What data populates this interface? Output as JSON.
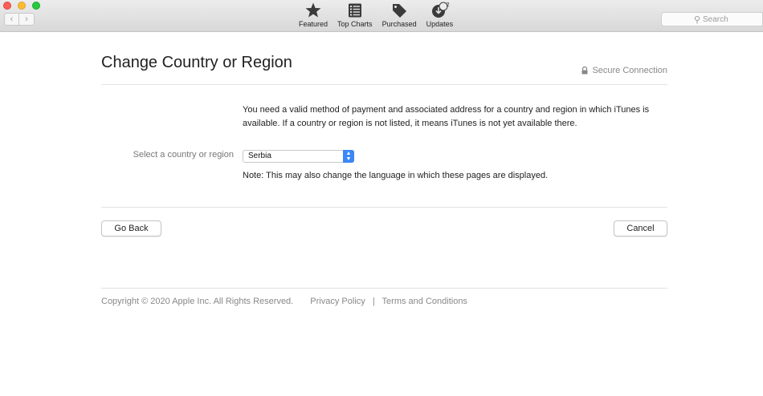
{
  "toolbar": {
    "tabs": [
      {
        "label": "Featured",
        "icon": "star-icon"
      },
      {
        "label": "Top Charts",
        "icon": "list-icon"
      },
      {
        "label": "Purchased",
        "icon": "tag-icon"
      },
      {
        "label": "Updates",
        "icon": "updates-icon",
        "badge": "2"
      }
    ],
    "search": {
      "placeholder": "Search"
    }
  },
  "page": {
    "title": "Change Country or Region",
    "secure_label": "Secure Connection",
    "info_text": "You need a valid method of payment and associated address for a country and region in which iTunes is available. If a country or region is not listed, it means iTunes is not yet available there.",
    "country_label": "Select a country or region",
    "country_value": "Serbia",
    "note": "Note: This may also change the language in which these pages are displayed.",
    "go_back_label": "Go Back",
    "cancel_label": "Cancel"
  },
  "footer": {
    "copyright": "Copyright © 2020 Apple Inc. All Rights Reserved.",
    "privacy": "Privacy Policy",
    "separator": "|",
    "terms": "Terms and Conditions"
  },
  "colors": {
    "accent": "#3a87f5",
    "close": "#fc5f57",
    "minimize": "#fdbc2e",
    "zoom": "#28c840"
  }
}
